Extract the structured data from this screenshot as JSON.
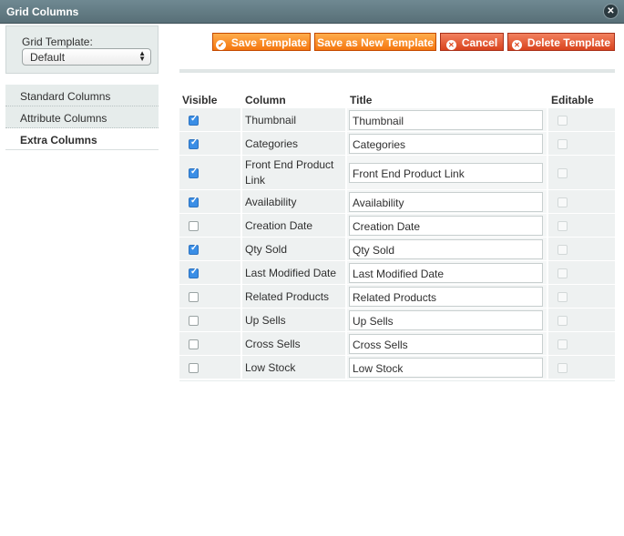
{
  "window": {
    "title": "Grid Columns",
    "close_icon": "close-icon"
  },
  "template": {
    "label": "Grid Template:",
    "selected": "Default"
  },
  "nav": [
    {
      "label": "Standard Columns",
      "active": false
    },
    {
      "label": "Attribute Columns",
      "active": false
    },
    {
      "label": "Extra Columns",
      "active": true
    }
  ],
  "toolbar": {
    "save": "Save Template",
    "save_new": "Save as New Template",
    "cancel": "Cancel",
    "delete": "Delete Template"
  },
  "grid": {
    "headers": {
      "visible": "Visible",
      "column": "Column",
      "title": "Title",
      "editable": "Editable"
    },
    "rows": [
      {
        "column": "Thumbnail",
        "title": "Thumbnail",
        "visible": true
      },
      {
        "column": "Categories",
        "title": "Categories",
        "visible": true
      },
      {
        "column": "Front End Product Link",
        "title": "Front End Product Link",
        "visible": true
      },
      {
        "column": "Availability",
        "title": "Availability",
        "visible": true
      },
      {
        "column": "Creation Date",
        "title": "Creation Date",
        "visible": false
      },
      {
        "column": "Qty Sold",
        "title": "Qty Sold",
        "visible": true
      },
      {
        "column": "Last Modified Date",
        "title": "Last Modified Date",
        "visible": true
      },
      {
        "column": "Related Products",
        "title": "Related Products",
        "visible": false
      },
      {
        "column": "Up Sells",
        "title": "Up Sells",
        "visible": false
      },
      {
        "column": "Cross Sells",
        "title": "Cross Sells",
        "visible": false
      },
      {
        "column": "Low Stock",
        "title": "Low Stock",
        "visible": false
      }
    ]
  },
  "colors": {
    "titlebar": "#607a82",
    "button_orange": "#f4760f",
    "button_red": "#d9431d",
    "checkbox_on": "#3a8ee6"
  }
}
